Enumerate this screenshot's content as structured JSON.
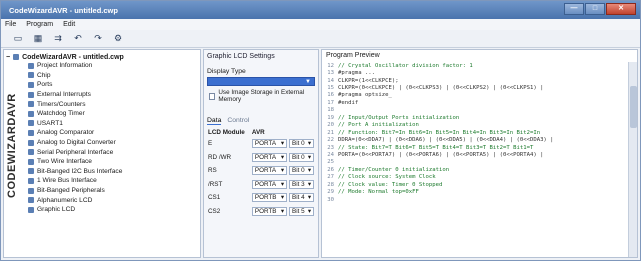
{
  "window": {
    "title": "CodeWizardAVR - untitled.cwp",
    "controls": {
      "minimize": "—",
      "maximize": "□",
      "close": "✕"
    }
  },
  "menu": {
    "items": [
      "File",
      "Program",
      "Edit"
    ]
  },
  "toolbar": {
    "icons": [
      "open-icon",
      "save-icon",
      "generate-icon",
      "undo-icon",
      "redo-icon",
      "run-icon"
    ]
  },
  "tree": {
    "root": "CodeWizardAVR - untitled.cwp",
    "logo_text": "CODEWIZARDAVR",
    "items": [
      "Project Information",
      "Chip",
      "Ports",
      "External Interrupts",
      "Timers/Counters",
      "Watchdog Timer",
      "USART1",
      "Analog Comparator",
      "Analog to Digital Converter",
      "Serial Peripheral Interface",
      "Two Wire Interface",
      "Bit-Banged I2C Bus Interface",
      "1 Wire Bus Interface",
      "Bit-Banged Peripherals",
      "Alphanumeric LCD",
      "Graphic LCD"
    ]
  },
  "settings": {
    "title": "Graphic LCD Settings",
    "display_type_label": "Display Type",
    "display_type_value": "",
    "checkbox_label": "Use Image Storage in External Memory",
    "tabs": [
      "Data",
      "Control"
    ],
    "grid_header": {
      "module": "LCD Module",
      "avr": "AVR"
    },
    "rows": [
      {
        "sig": "E",
        "port": "PORTA",
        "bit": "Bit 0"
      },
      {
        "sig": "RD /WR",
        "port": "PORTA",
        "bit": "Bit 0"
      },
      {
        "sig": "RS",
        "port": "PORTA",
        "bit": "Bit 0"
      },
      {
        "sig": "/RST",
        "port": "PORTA",
        "bit": "Bit 3"
      },
      {
        "sig": "CS1",
        "port": "PORTB",
        "bit": "Bit 4"
      },
      {
        "sig": "CS2",
        "port": "PORTB",
        "bit": "Bit 5"
      }
    ]
  },
  "preview": {
    "title": "Program Preview",
    "lines": [
      {
        "n": "12",
        "t": "// Crystal Oscillator division factor: 1",
        "c": true
      },
      {
        "n": "13",
        "t": "#pragma ...",
        "c": false
      },
      {
        "n": "14",
        "t": "CLKPR=(1<<CLKPCE);",
        "c": false
      },
      {
        "n": "15",
        "t": "CLKPR=(0<<CLKPCE) | (0<<CLKPS3) | (0<<CLKPS2) | (0<<CLKPS1) |",
        "c": false
      },
      {
        "n": "16",
        "t": "#pragma optsize_",
        "c": false
      },
      {
        "n": "17",
        "t": "#endif",
        "c": false
      },
      {
        "n": "18",
        "t": "",
        "c": false
      },
      {
        "n": "19",
        "t": "// Input/Output Ports initialization",
        "c": true
      },
      {
        "n": "20",
        "t": "// Port A initialization",
        "c": true
      },
      {
        "n": "21",
        "t": "// Function: Bit7=In Bit6=In Bit5=In Bit4=In Bit3=In Bit2=In",
        "c": true
      },
      {
        "n": "22",
        "t": "DDRA=(0<<DDA7) | (0<<DDA6) | (0<<DDA5) | (0<<DDA4) | (0<<DDA3) |",
        "c": false
      },
      {
        "n": "23",
        "t": "// State: Bit7=T Bit6=T Bit5=T Bit4=T Bit3=T Bit2=T Bit1=T",
        "c": true
      },
      {
        "n": "24",
        "t": "PORTA=(0<<PORTA7) | (0<<PORTA6) | (0<<PORTA5) | (0<<PORTA4) |",
        "c": false
      },
      {
        "n": "25",
        "t": "",
        "c": false
      },
      {
        "n": "26",
        "t": "// Timer/Counter 0 initialization",
        "c": true
      },
      {
        "n": "27",
        "t": "// Clock source: System Clock",
        "c": true
      },
      {
        "n": "28",
        "t": "// Clock value: Timer 0 Stopped",
        "c": true
      },
      {
        "n": "29",
        "t": "// Mode: Normal top=0xFF",
        "c": true
      },
      {
        "n": "30",
        "t": "",
        "c": false
      }
    ]
  }
}
